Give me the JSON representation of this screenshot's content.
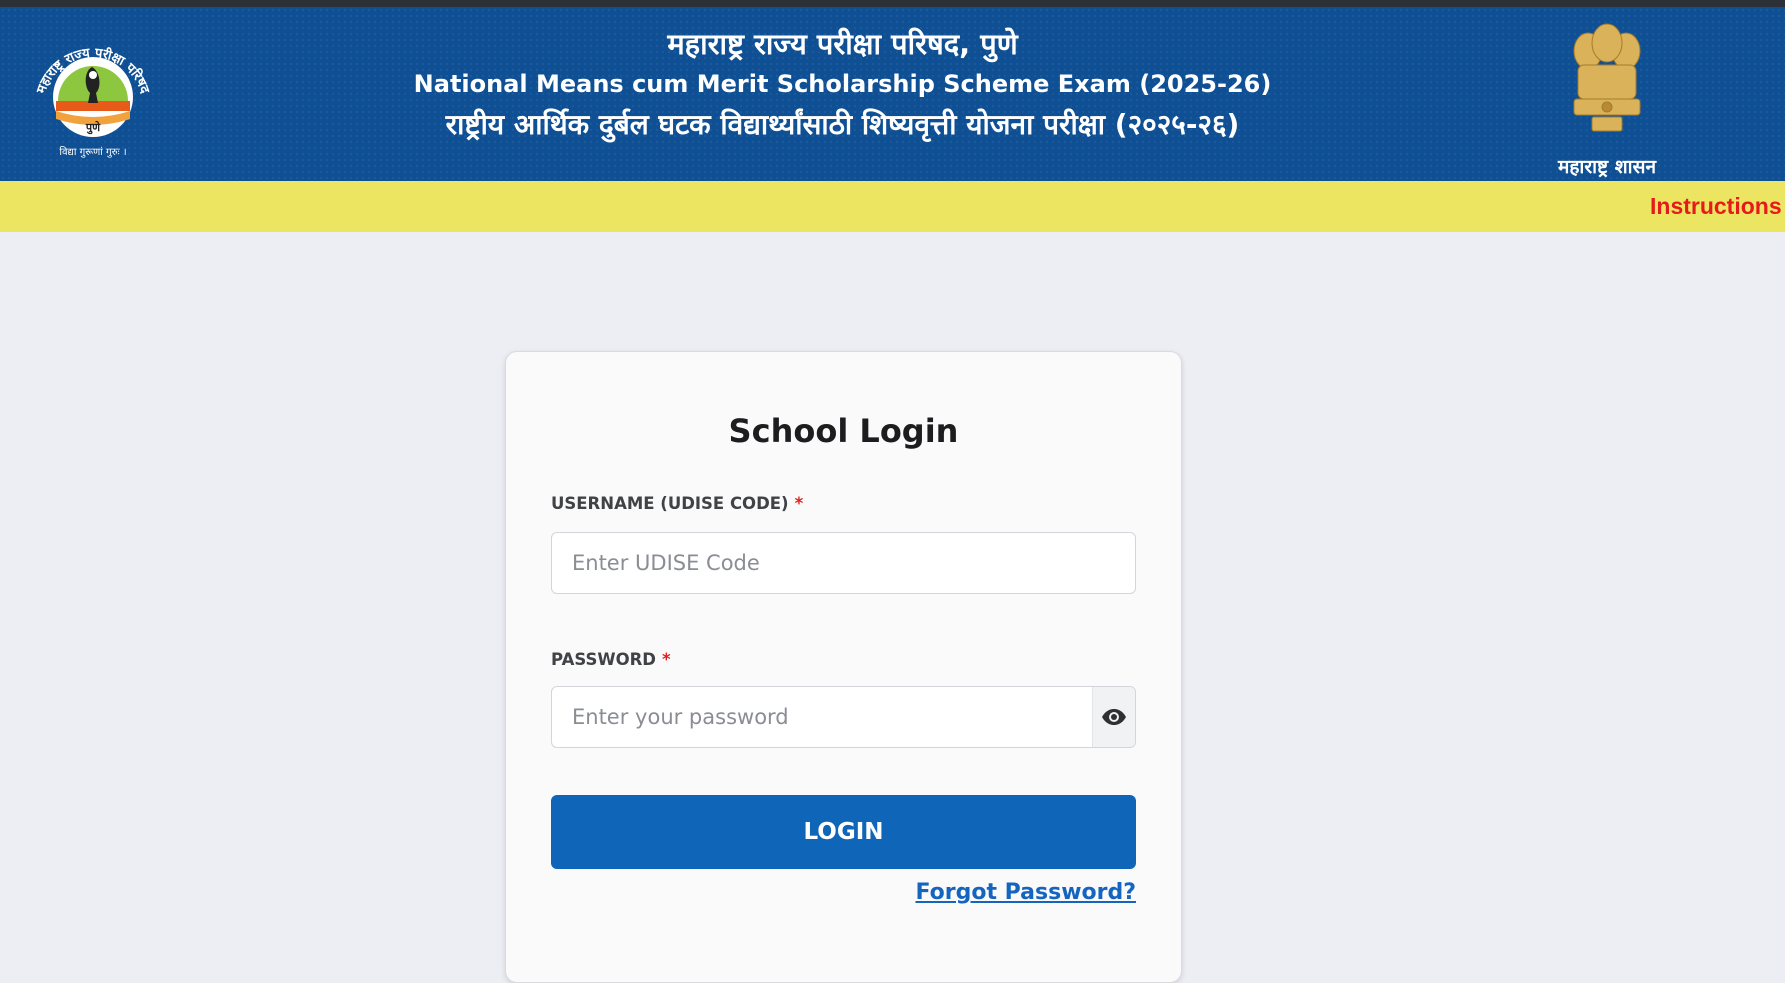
{
  "header": {
    "title_marathi": "महाराष्ट्र राज्य परीक्षा परिषद, पुणे",
    "title_english": "National Means cum Merit Scholarship Scheme Exam (2025-26)",
    "title_marathi_exam": "राष्ट्रीय आर्थिक दुर्बल घटक विद्यार्थ्यांसाठी शिष्यवृत्ती योजना परीक्षा (२०२५-२६)",
    "left_logo": {
      "arc_text": "महाराष्ट्र राज्य परीक्षा परिषद",
      "city": "पुणे",
      "motto": "विद्या गुरूणां गुरुः ।",
      "icon": "state-exam-council-logo"
    },
    "right_logo": {
      "caption": "महाराष्ट्र शासन",
      "icon": "state-emblem"
    }
  },
  "marquee": {
    "text": "Instructions"
  },
  "login": {
    "title": "School Login",
    "username_label": "USERNAME (UDISE CODE)",
    "username_placeholder": "Enter UDISE Code",
    "username_value": "",
    "password_label": "PASSWORD",
    "password_placeholder": "Enter your password",
    "password_value": "",
    "required_mark": "*",
    "toggle_icon": "eye-icon",
    "login_button": "LOGIN",
    "forgot_link": "Forgot Password?"
  },
  "colors": {
    "header_blue": "#0f4f94",
    "marquee_yellow": "#ece562",
    "marquee_text_red": "#e51b1b",
    "login_button_blue": "#0f66b8",
    "link_blue": "#1565c0",
    "required_red": "#e31e1e"
  }
}
